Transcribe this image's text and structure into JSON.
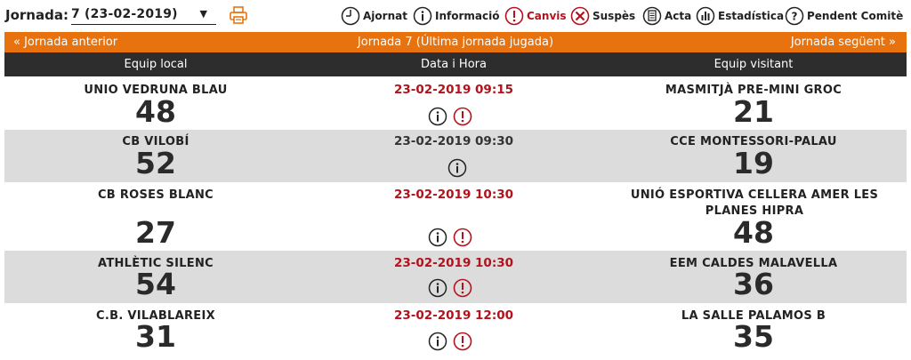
{
  "toolbar": {
    "jornada_label": "Jornada:",
    "jornada_value": "7 (23-02-2019)",
    "legend": [
      {
        "label": "Ajornat",
        "icon": "clock-icon",
        "color": "#222222"
      },
      {
        "label": "Informació",
        "icon": "info-icon",
        "color": "#222222"
      },
      {
        "label": "Canvis",
        "icon": "alert-icon",
        "color": "#b2121c"
      },
      {
        "label": "Suspès",
        "icon": "cross-icon",
        "color": "#222222"
      },
      {
        "label": "Acta",
        "icon": "document-icon",
        "color": "#222222"
      },
      {
        "label": "Estadística",
        "icon": "stats-icon",
        "color": "#222222"
      },
      {
        "label": "Pendent Comitè",
        "icon": "question-icon",
        "color": "#222222"
      }
    ]
  },
  "nav": {
    "prev": "«  Jornada anterior",
    "current": "Jornada 7 (Última jornada jugada)",
    "next": "Jornada següent  »"
  },
  "table": {
    "headers": [
      "Equip local",
      "Data i Hora",
      "Equip visitant"
    ],
    "rows": [
      {
        "home": "UNIO VEDRUNA BLAU",
        "home_score": "48",
        "datetime": "23-02-2019 09:15",
        "away": "MASMITJÀ PRE-MINI GROC",
        "away_score": "21",
        "changed": true
      },
      {
        "home": "CB VILOBÍ",
        "home_score": "52",
        "datetime": "23-02-2019 09:30",
        "away": "CCE MONTESSORI-PALAU",
        "away_score": "19",
        "changed": false
      },
      {
        "home": "CB ROSES BLANC",
        "home_score": "27",
        "datetime": "23-02-2019 10:30",
        "away": "UNIÓ ESPORTIVA CELLERA AMER LES PLANES HIPRA",
        "away_score": "48",
        "changed": true
      },
      {
        "home": "ATHLÈTIC SILENC",
        "home_score": "54",
        "datetime": "23-02-2019 10:30",
        "away": "EEM CALDES MALAVELLA",
        "away_score": "36",
        "changed": true
      },
      {
        "home": "C.B. VILABLAREIX",
        "home_score": "31",
        "datetime": "23-02-2019 12:00",
        "away": "LA SALLE PALAMOS B",
        "away_score": "35",
        "changed": true
      }
    ]
  },
  "colors": {
    "accent": "#e8730e",
    "header_bg": "#2d2d2d",
    "alert_red": "#b2121c",
    "alt_row": "#dcdcdc"
  }
}
